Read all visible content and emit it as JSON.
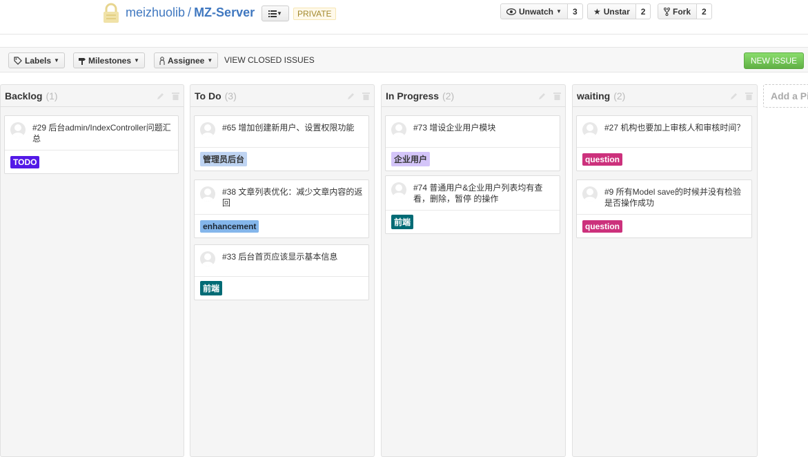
{
  "header": {
    "owner": "meizhuolib",
    "separator": "/",
    "repo": "MZ-Server",
    "private_label": "PRIVATE",
    "watch_label": "Unwatch",
    "watch_count": "3",
    "star_label": "Unstar",
    "star_count": "2",
    "fork_label": "Fork",
    "fork_count": "2"
  },
  "toolbar": {
    "labels_btn": "Labels",
    "milestones_btn": "Milestones",
    "assignee_btn": "Assignee",
    "closed_link": "VIEW CLOSED ISSUES",
    "new_issue": "NEW ISSUE"
  },
  "columns": [
    {
      "name": "Backlog",
      "count": "(1)",
      "cards": [
        {
          "title": "#29 后台admin/IndexController问题汇总",
          "label": "TODO",
          "label_bg": "#5319e7",
          "label_fg": "#ffffff"
        }
      ]
    },
    {
      "name": "To Do",
      "count": "(3)",
      "cards": [
        {
          "title": "#65 增加创建新用户、设置权限功能",
          "label": "管理员后台",
          "label_bg": "#bfd4f2",
          "label_fg": "#333333"
        },
        {
          "title": "#38 文章列表优化：减少文章内容的返回",
          "label": "enhancement",
          "label_bg": "#84b6eb",
          "label_fg": "#1c2733"
        },
        {
          "title": "#33 后台首页应该显示基本信息",
          "label": "前端",
          "label_bg": "#006b75",
          "label_fg": "#ffffff"
        }
      ]
    },
    {
      "name": "In Progress",
      "count": "(2)",
      "cards": [
        {
          "title": "#73 增设企业用户模块",
          "label": "企业用户",
          "label_bg": "#d4c5f9",
          "label_fg": "#333333"
        },
        {
          "title": "#74 普通用户&企业用户列表均有查看，删除，暂停 的操作",
          "label": "前端",
          "label_bg": "#006b75",
          "label_fg": "#ffffff"
        }
      ]
    },
    {
      "name": "waiting",
      "count": "(2)",
      "cards": [
        {
          "title": "#27 机构也要加上审核人和审核时间？",
          "label": "question",
          "label_bg": "#cc317c",
          "label_fg": "#ffffff"
        },
        {
          "title": "#9 所有Model save的时候并没有检验是否操作成功",
          "label": "question",
          "label_bg": "#cc317c",
          "label_fg": "#ffffff"
        }
      ]
    }
  ],
  "add_pipeline": "Add a Pipeline"
}
